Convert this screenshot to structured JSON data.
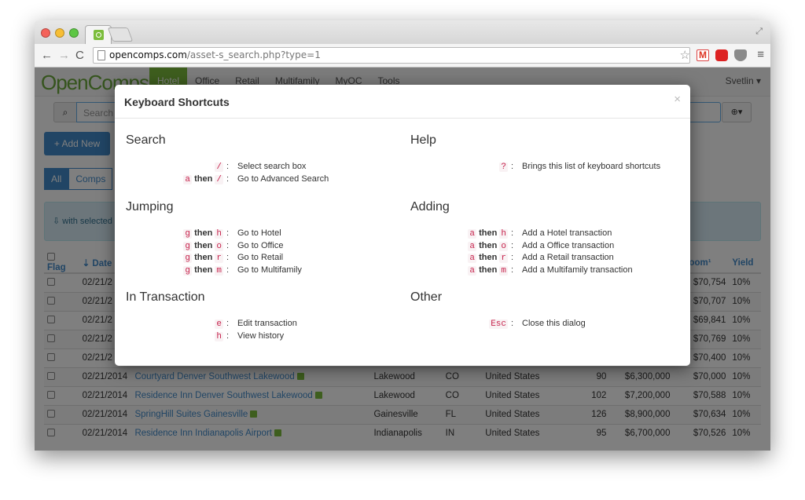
{
  "browser": {
    "url_host": "opencomps.com",
    "url_path": "/asset-s_search.php?type=1"
  },
  "app": {
    "brand": "OpenComps",
    "nav": [
      "Hotel",
      "Office",
      "Retail",
      "Multifamily",
      "MyOC",
      "Tools"
    ],
    "active_nav": "Hotel",
    "user": "Svetlin",
    "search_placeholder": "Search",
    "add_new": "+ Add New",
    "filters": [
      "All",
      "Comps"
    ],
    "alert_text": "with selected",
    "table": {
      "headers": [
        "Flag",
        "Date",
        "",
        "",
        "",
        "",
        "",
        "",
        "r Room¹",
        "Yield"
      ],
      "rows": [
        [
          "02/21/2",
          "",
          "",
          "",
          "",
          "",
          "",
          "$70,754",
          "10%"
        ],
        [
          "02/21/2",
          "",
          "",
          "",
          "",
          "",
          "",
          "$70,707",
          "10%"
        ],
        [
          "02/21/2",
          "",
          "",
          "",
          "",
          "",
          "",
          "$69,841",
          "10%"
        ],
        [
          "02/21/2",
          "",
          "",
          "",
          "",
          "",
          "",
          "$70,769",
          "10%"
        ],
        [
          "02/21/2",
          "",
          "",
          "",
          "",
          "",
          "",
          "$70,400",
          "10%"
        ],
        [
          "02/21/2014",
          "Courtyard Denver Southwest Lakewood",
          "Lakewood",
          "CO",
          "United States",
          "90",
          "$6,300,000",
          "$70,000",
          "10%"
        ],
        [
          "02/21/2014",
          "Residence Inn Denver Southwest Lakewood",
          "Lakewood",
          "CO",
          "United States",
          "102",
          "$7,200,000",
          "$70,588",
          "10%"
        ],
        [
          "02/21/2014",
          "SpringHill Suites Gainesville",
          "Gainesville",
          "FL",
          "United States",
          "126",
          "$8,900,000",
          "$70,634",
          "10%"
        ],
        [
          "02/21/2014",
          "Residence Inn Indianapolis Airport",
          "Indianapolis",
          "IN",
          "United States",
          "95",
          "$6,700,000",
          "$70,526",
          "10%"
        ]
      ]
    }
  },
  "modal": {
    "title": "Keyboard Shortcuts",
    "close": "×",
    "sections": {
      "search": {
        "title": "Search",
        "rows": [
          {
            "keys": [
              "/"
            ],
            "desc": "Select search box"
          },
          {
            "keys": [
              "a",
              "/"
            ],
            "desc": "Go to Advanced Search"
          }
        ]
      },
      "help": {
        "title": "Help",
        "rows": [
          {
            "keys": [
              "?"
            ],
            "desc": "Brings this list of keyboard shortcuts"
          }
        ]
      },
      "jumping": {
        "title": "Jumping",
        "rows": [
          {
            "keys": [
              "g",
              "h"
            ],
            "desc": "Go to Hotel"
          },
          {
            "keys": [
              "g",
              "o"
            ],
            "desc": "Go to Office"
          },
          {
            "keys": [
              "g",
              "r"
            ],
            "desc": "Go to Retail"
          },
          {
            "keys": [
              "g",
              "m"
            ],
            "desc": "Go to Multifamily"
          }
        ]
      },
      "adding": {
        "title": "Adding",
        "rows": [
          {
            "keys": [
              "a",
              "h"
            ],
            "desc": "Add a Hotel transaction"
          },
          {
            "keys": [
              "a",
              "o"
            ],
            "desc": "Add a Office transaction"
          },
          {
            "keys": [
              "a",
              "r"
            ],
            "desc": "Add a Retail transaction"
          },
          {
            "keys": [
              "a",
              "m"
            ],
            "desc": "Add a Multifamily transaction"
          }
        ]
      },
      "transaction": {
        "title": "In Transaction",
        "rows": [
          {
            "keys": [
              "e"
            ],
            "desc": "Edit transaction"
          },
          {
            "keys": [
              "h"
            ],
            "desc": "View history"
          }
        ]
      },
      "other": {
        "title": "Other",
        "rows": [
          {
            "keys": [
              "Esc"
            ],
            "desc": "Close this dialog"
          }
        ]
      }
    },
    "then_word": "then",
    "colon": ":"
  }
}
